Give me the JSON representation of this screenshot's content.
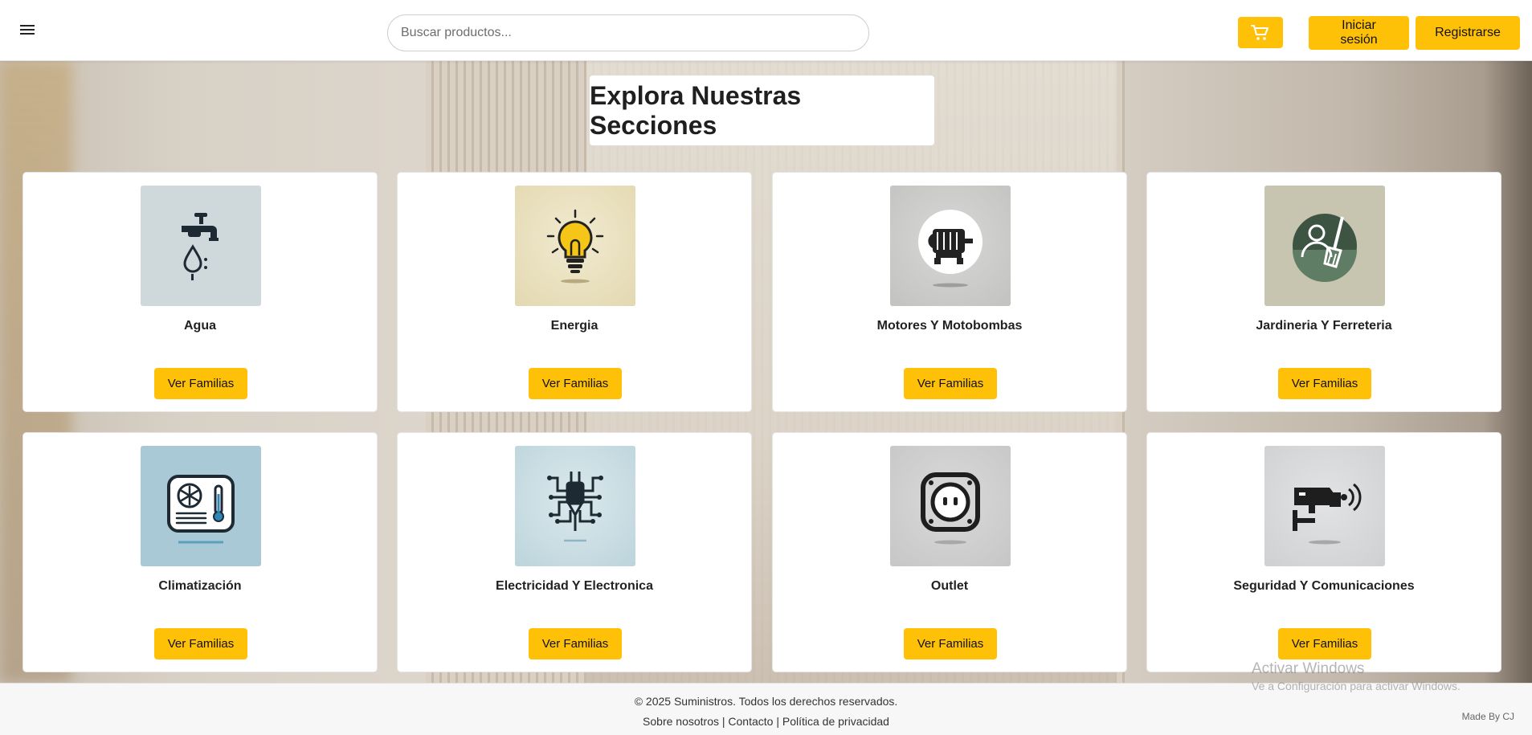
{
  "header": {
    "search_placeholder": "Buscar productos...",
    "login_label": "Iniciar sesión",
    "register_label": "Registrarse"
  },
  "main": {
    "title": "Explora Nuestras Secciones",
    "sections": [
      {
        "name": "Agua",
        "button": "Ver Familias",
        "icon": "water-faucet-icon",
        "bg": "#cfd8da"
      },
      {
        "name": "Energia",
        "button": "Ver Familias",
        "icon": "lightbulb-icon",
        "bg": "#e6dcb9"
      },
      {
        "name": "Motores Y Motobombas",
        "button": "Ver Familias",
        "icon": "motor-icon",
        "bg": "#c9c9c7"
      },
      {
        "name": "Jardineria Y Ferreteria",
        "button": "Ver Familias",
        "icon": "gardener-shovel-icon",
        "bg": "#c7c4b0"
      },
      {
        "name": "Climatización",
        "button": "Ver Familias",
        "icon": "air-conditioner-icon",
        "bg": "#a9c9d6"
      },
      {
        "name": "Electricidad Y Electronica",
        "button": "Ver Familias",
        "icon": "electric-plug-circuit-icon",
        "bg": "#c3dbe2"
      },
      {
        "name": "Outlet",
        "button": "Ver Familias",
        "icon": "power-outlet-icon",
        "bg": "#cfcfcf"
      },
      {
        "name": "Seguridad Y Comunicaciones",
        "button": "Ver Familias",
        "icon": "security-camera-icon",
        "bg": "#d6d7d8"
      }
    ]
  },
  "footer": {
    "copyright": "© 2025 Suministros. Todos los derechos reservados.",
    "link_about": "Sobre nosotros",
    "link_contact": "Contacto",
    "link_privacy": "Política de privacidad",
    "separator": "|",
    "made_by": "Made By CJ"
  },
  "watermark": {
    "line1": "Activar Windows",
    "line2": "Ve a Configuración para activar Windows."
  },
  "colors": {
    "accent": "#ffc107",
    "dark_icon": "#1e2a33"
  }
}
